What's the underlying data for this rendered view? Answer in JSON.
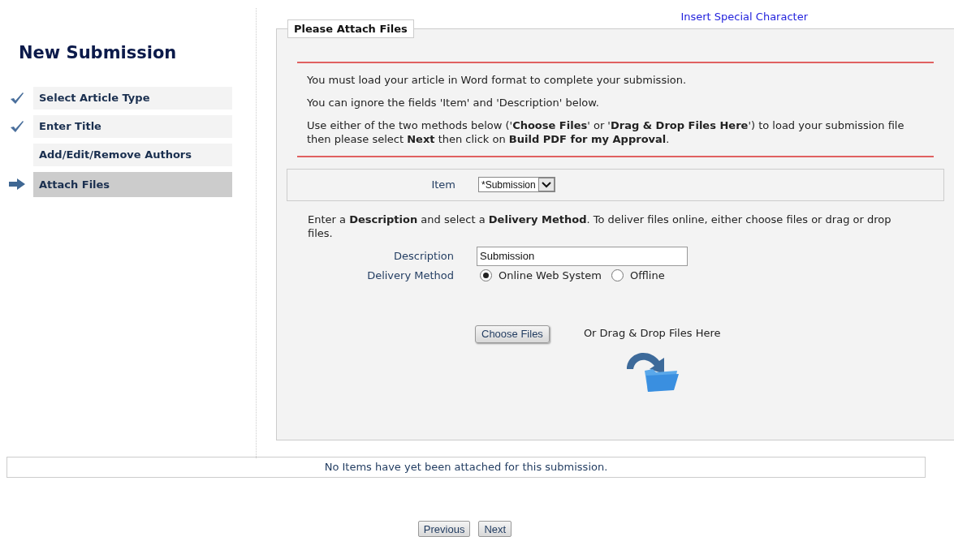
{
  "sidebar": {
    "title": "New Submission",
    "steps": [
      {
        "label": "Select Article Type",
        "completed": true,
        "selected": false
      },
      {
        "label": "Enter Title",
        "completed": true,
        "selected": false
      },
      {
        "label": "Add/Edit/Remove Authors",
        "completed": false,
        "selected": false
      },
      {
        "label": "Attach Files",
        "completed": false,
        "selected": true
      }
    ]
  },
  "special_character_link": "Insert Special Character",
  "panel": {
    "legend": "Please Attach Files",
    "instructions": [
      "You must load your article in Word format to complete your submission.",
      "You can ignore the fields 'Item' and 'Description' below.",
      "Use either of the two methods below ('**Choose Files**' or '**Drag & Drop Files Here**') to load your submission file then please select **Next** then click on **Build PDF for my Approval**."
    ],
    "item": {
      "label": "Item",
      "value": "*Submission"
    },
    "delivery_note": "Enter a **Description** and select a **Delivery Method**. To deliver files online, either choose files or drag or drop files.",
    "description": {
      "label": "Description",
      "value": "Submission"
    },
    "delivery_method": {
      "label": "Delivery Method",
      "options": [
        {
          "label": "Online Web System",
          "selected": true
        },
        {
          "label": "Offline",
          "selected": false
        }
      ]
    },
    "choose_files_button": "Choose Files",
    "drop_label": "Or Drag & Drop Files Here"
  },
  "attachments_message": "No Items have yet been attached for this submission.",
  "buttons": [
    "Previous",
    "Next"
  ]
}
